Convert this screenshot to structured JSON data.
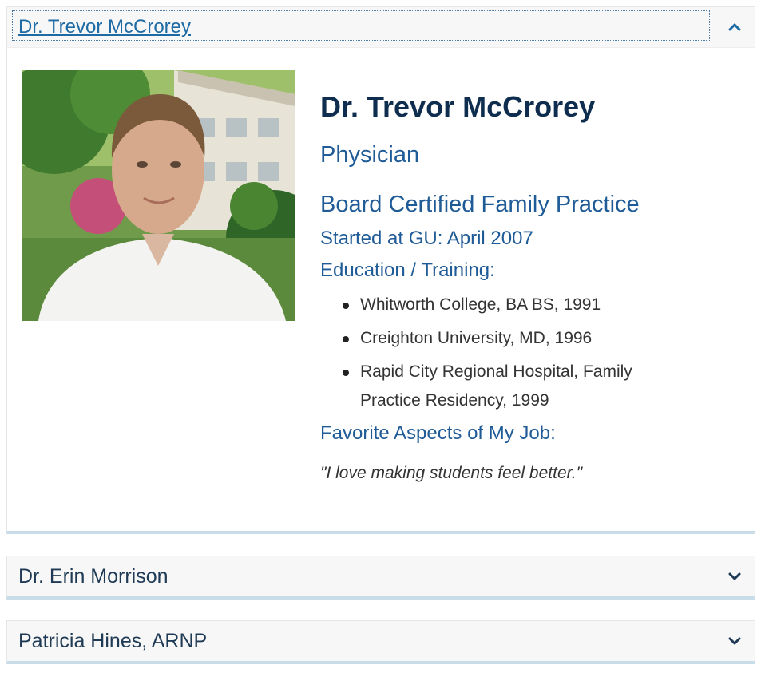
{
  "accordion": {
    "open_item": {
      "header": "Dr. Trevor McCrorey",
      "name": "Dr. Trevor McCrorey",
      "role": "Physician",
      "certification": "Board Certified Family Practice",
      "started": "Started at GU: April 2007",
      "education_heading": "Education / Training:",
      "education": [
        "Whitworth College, BA BS, 1991",
        "Creighton University, MD, 1996",
        "Rapid City Regional Hospital, Family Practice Residency, 1999"
      ],
      "favorite_heading": "Favorite Aspects of My Job:",
      "quote": "\"I love making students feel better.\""
    },
    "collapsed_items": [
      {
        "header": "Dr. Erin Morrison"
      },
      {
        "header": "Patricia Hines, ARNP"
      }
    ]
  },
  "icons": {
    "expanded": "chevron-up-icon",
    "collapsed": "chevron-down-icon"
  },
  "colors": {
    "heading": "#0f2e4f",
    "accent": "#1f5b96",
    "link": "#1d6aa5",
    "border_accent": "#c9dde9"
  }
}
